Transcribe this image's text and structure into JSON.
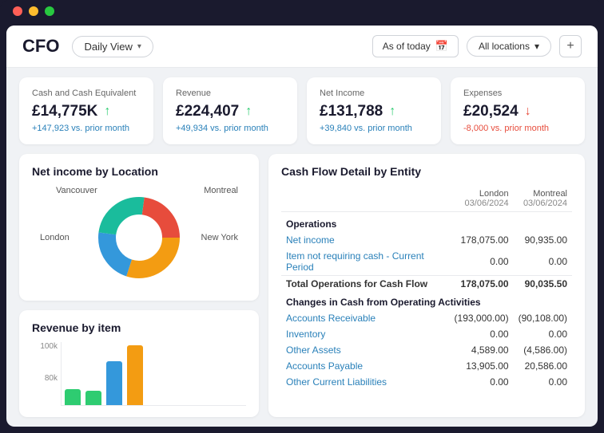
{
  "titlebar": {
    "dots": [
      "red",
      "yellow",
      "green"
    ]
  },
  "header": {
    "title": "CFO",
    "daily_view_label": "Daily View",
    "chevron": "▾",
    "as_of_today": "As of today",
    "calendar_icon": "📅",
    "all_locations": "All locations",
    "all_locations_chevron": "▾",
    "plus": "+"
  },
  "kpis": [
    {
      "label": "Cash and Cash Equivalent",
      "value": "£14,775K",
      "arrow": "up",
      "change": "+147,923 vs. prior month"
    },
    {
      "label": "Revenue",
      "value": "£224,407",
      "arrow": "up",
      "change": "+49,934 vs. prior month"
    },
    {
      "label": "Net Income",
      "value": "£131,788",
      "arrow": "up",
      "change": "+39,840 vs. prior month"
    },
    {
      "label": "Expenses",
      "value": "£20,524",
      "arrow": "down",
      "change": "-8,000 vs. prior month"
    }
  ],
  "net_income_by_location": {
    "title": "Net income by Location",
    "labels": {
      "vancouver": "Vancouver",
      "montreal": "Montreal",
      "london": "London",
      "new_york": "New York"
    },
    "segments": [
      {
        "color": "#f39c12",
        "pct": 30
      },
      {
        "color": "#3498db",
        "pct": 22
      },
      {
        "color": "#1abc9c",
        "pct": 25
      },
      {
        "color": "#e74c3c",
        "pct": 23
      }
    ]
  },
  "revenue_by_item": {
    "title": "Revenue by item",
    "y_labels": [
      "100k",
      "80k"
    ],
    "bars": [
      {
        "color": "#2ecc71",
        "height": 20
      },
      {
        "color": "#2ecc71",
        "height": 18
      },
      {
        "color": "#3498db",
        "height": 55
      },
      {
        "color": "#f39c12",
        "height": 75
      }
    ]
  },
  "cash_flow": {
    "title": "Cash Flow Detail by Entity",
    "columns": [
      {
        "name": "",
        "sub": ""
      },
      {
        "name": "London",
        "sub": "03/06/2024"
      },
      {
        "name": "Montreal",
        "sub": "03/06/2024"
      }
    ],
    "sections": [
      {
        "header": "Operations",
        "rows": [
          {
            "label": "Net income",
            "link": true,
            "london": "178,075.00",
            "montreal": "90,935.00"
          },
          {
            "label": "Item not requiring cash - Current Period",
            "link": true,
            "london": "0.00",
            "montreal": "0.00"
          }
        ],
        "total": {
          "label": "Total Operations for Cash Flow",
          "london": "178,075.00",
          "montreal": "90,035.50"
        }
      },
      {
        "header": "Changes in Cash from Operating Activities",
        "rows": [
          {
            "label": "Accounts Receivable",
            "link": true,
            "london": "(193,000.00)",
            "montreal": "(90,108.00)"
          },
          {
            "label": "Inventory",
            "link": true,
            "london": "0.00",
            "montreal": "0.00"
          },
          {
            "label": "Other Assets",
            "link": true,
            "london": "4,589.00",
            "montreal": "(4,586.00)"
          },
          {
            "label": "Accounts Payable",
            "link": true,
            "london": "13,905.00",
            "montreal": "20,586.00"
          },
          {
            "label": "Other Current Liabilities",
            "link": true,
            "london": "0.00",
            "montreal": "0.00"
          }
        ]
      }
    ]
  }
}
